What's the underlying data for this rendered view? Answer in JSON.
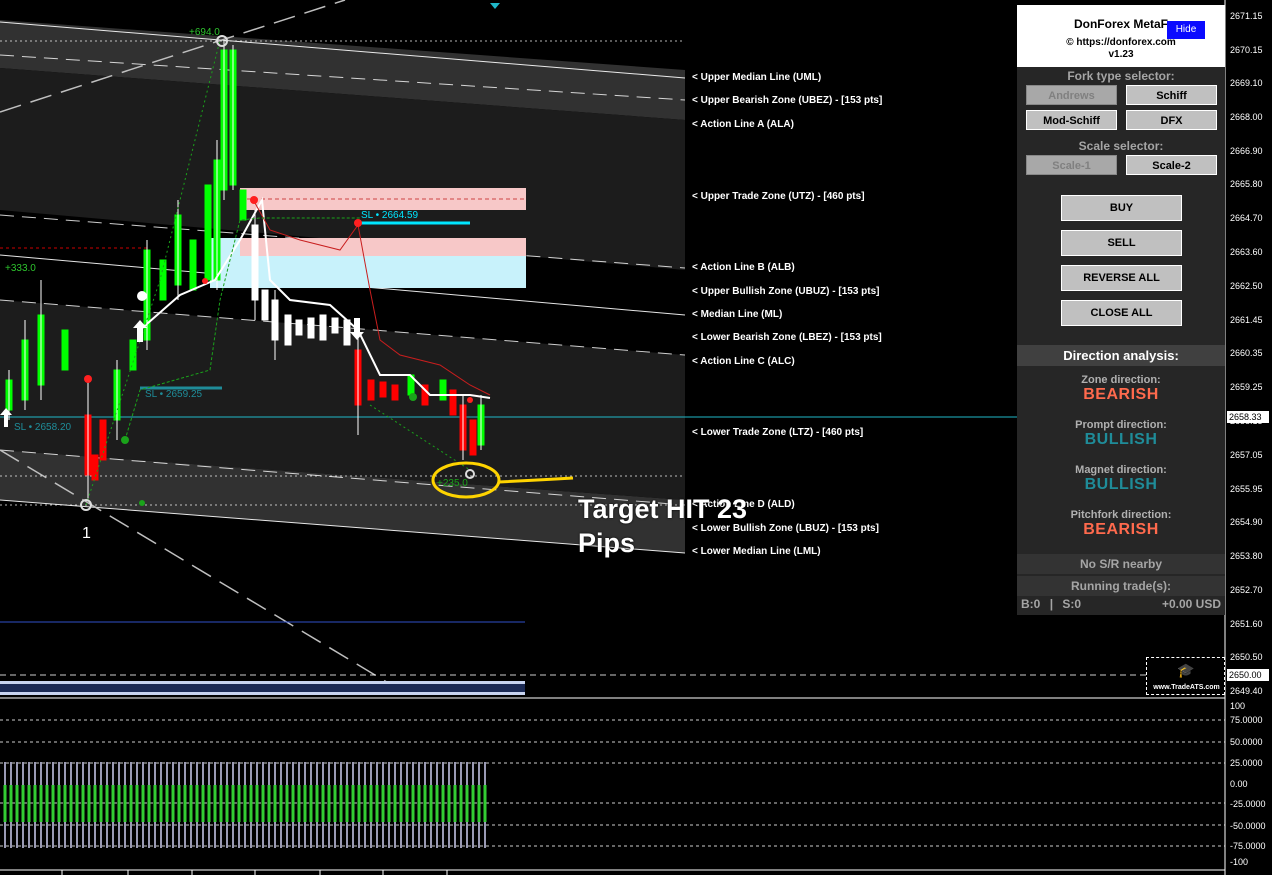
{
  "price_axis": {
    "ticks": [
      "2671.15",
      "2670.15",
      "2669.10",
      "2668.00",
      "2666.90",
      "2665.80",
      "2664.70",
      "2663.60",
      "2662.50",
      "2661.45",
      "2660.35",
      "2659.25",
      "2658.15",
      "2657.05",
      "2655.95",
      "2654.90",
      "2653.80",
      "2652.70",
      "2651.60",
      "2650.50",
      "2649.40"
    ],
    "current_price": "2658.33",
    "level_price": "2650.00"
  },
  "indicator_axis": {
    "ticks": [
      "100",
      "75.0000",
      "50.0000",
      "25.0000",
      "0.00",
      "-25.0000",
      "-50.0000",
      "-75.0000",
      "-100"
    ]
  },
  "line_labels": [
    "< Upper Median Line (UML)",
    "< Upper Bearish Zone (UBEZ) - [153 pts]",
    "< Action Line A (ALA)",
    "< Upper Trade Zone (UTZ) - [460 pts]",
    "< Action Line B (ALB)",
    "< Upper Bullish Zone (UBUZ) - [153 pts]",
    "< Median Line (ML)",
    "< Lower Bearish Zone (LBEZ) - [153 pts]",
    "< Action Line C (ALC)",
    "< Lower Trade Zone (LTZ) - [460 pts]",
    "< Action Line D (ALD)",
    "< Lower Bullish Zone (LBUZ) - [153 pts]",
    "< Lower Median Line (LML)"
  ],
  "chart_texts": {
    "top_pts": "+694.0",
    "left_pts": "+333.0",
    "target_pts": "+235.0",
    "sl_upper": "SL • 2664.59",
    "sl_mid": "SL • 2659.25",
    "sl_left": "SL • 2658.20",
    "pivot_label": "1"
  },
  "annotation": {
    "line1": "Target HIT 23",
    "line2": "Pips"
  },
  "panel": {
    "title": "DonForex MetaF",
    "hide_label": "Hide",
    "url": "© https://donforex.com",
    "version": "v1.23",
    "fork_selector_title": "Fork type selector:",
    "fork_buttons": [
      "Andrews",
      "Schiff",
      "Mod-Schiff",
      "DFX"
    ],
    "scale_selector_title": "Scale selector:",
    "scale_buttons": [
      "Scale-1",
      "Scale-2"
    ],
    "trade_buttons": [
      "BUY",
      "SELL",
      "REVERSE ALL",
      "CLOSE ALL"
    ],
    "direction_header": "Direction analysis:",
    "directions": [
      {
        "label": "Zone direction:",
        "value": "BEARISH",
        "color": "#ff6a4d"
      },
      {
        "label": "Prompt direction:",
        "value": "BULLISH",
        "color": "#1f8c99"
      },
      {
        "label": "Magnet direction:",
        "value": "BULLISH",
        "color": "#1f8c99"
      },
      {
        "label": "Pitchfork direction:",
        "value": "BEARISH",
        "color": "#ff6a4d"
      }
    ],
    "sr_status": "No S/R nearby",
    "running_title": "Running trade(s):",
    "buy_count": "B:0",
    "separator": "|",
    "sell_count": "S:0",
    "pnl": "+0.00 USD"
  },
  "logo": {
    "text": "www.TradeATS.com",
    "icon": "graduation-cap-icon"
  },
  "colors": {
    "bull_candle": "#00ff00",
    "bear_candle": "#ff0000",
    "utz_fill": "#f7c8c8",
    "ltz_fill": "#c8f2fb",
    "target_circle": "#ffd400",
    "sl_line": "#00e5ff"
  }
}
